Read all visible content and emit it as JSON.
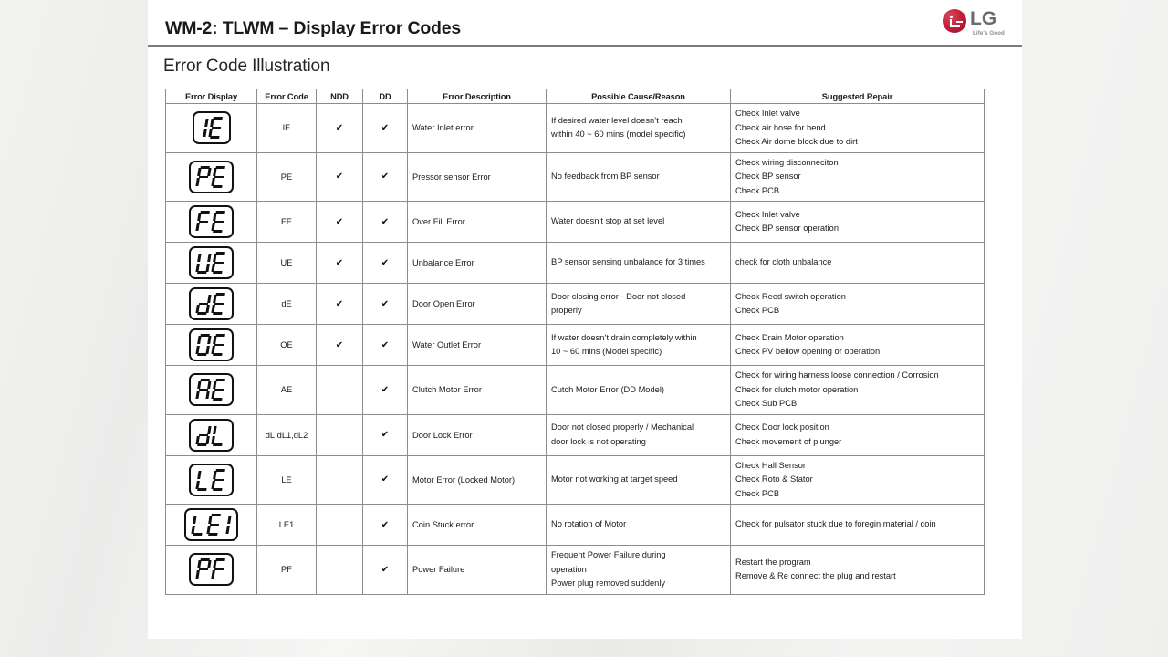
{
  "slide": {
    "title": "WM-2: TLWM – Display Error Codes",
    "section_heading": "Error Code Illustration",
    "logo": {
      "wordmark": "LG",
      "tagline": "Life's Good",
      "brand_color": "#c0203a"
    }
  },
  "table": {
    "columns": [
      "Error Display",
      "Error Code",
      "NDD",
      "DD",
      "Error Description",
      "Possible Cause/Reason",
      "Suggested Repair"
    ],
    "check_glyph": "✔",
    "rows": [
      {
        "display_segments": "1E",
        "code": "IE",
        "ndd": true,
        "dd": true,
        "description": "Water Inlet error",
        "cause": [
          "If desired water level doesn’t reach",
          "within 40 ~ 60 mins (model specific)"
        ],
        "repair": [
          "Check Inlet valve",
          "Check air hose for bend",
          "Check Air dome block due to dirt"
        ]
      },
      {
        "display_segments": "PE",
        "code": "PE",
        "ndd": true,
        "dd": true,
        "description": "Pressor sensor Error",
        "cause": [
          "No feedback from BP sensor"
        ],
        "repair": [
          "Check wiring disconneciton",
          "Check BP sensor",
          "Check PCB"
        ]
      },
      {
        "display_segments": "FE",
        "code": "FE",
        "ndd": true,
        "dd": true,
        "description": "Over Fill Error",
        "cause": [
          "Water doesn’t stop at set level"
        ],
        "repair": [
          "Check Inlet valve",
          "Check BP sensor operation"
        ]
      },
      {
        "display_segments": "UE",
        "code": "UE",
        "ndd": true,
        "dd": true,
        "description": "Unbalance Error",
        "cause": [
          "BP sensor sensing unbalance for 3 times"
        ],
        "repair": [
          "check for cloth unbalance"
        ]
      },
      {
        "display_segments": "dE",
        "code": "dE",
        "ndd": true,
        "dd": true,
        "description": "Door Open Error",
        "cause": [
          "Door closing error - Door not closed",
          "properly"
        ],
        "repair": [
          "Check Reed switch operation",
          "Check PCB"
        ]
      },
      {
        "display_segments": "OE",
        "code": "OE",
        "ndd": true,
        "dd": true,
        "description": "Water Outlet Error",
        "cause": [
          "If water doesn’t drain completely within",
          "10 ~ 60 mins (Model specific)"
        ],
        "repair": [
          "Check Drain Motor operation",
          "Check PV bellow opening or operation"
        ]
      },
      {
        "display_segments": "AE",
        "code": "AE",
        "ndd": false,
        "dd": true,
        "description": "Clutch Motor Error",
        "cause": [
          "Cutch Motor Error (DD Model)"
        ],
        "repair": [
          "Check for wiring harness loose connection / Corrosion",
          "Check for clutch motor operation",
          "Check Sub PCB"
        ]
      },
      {
        "display_segments": "dL",
        "code": "dL,dL1,dL2",
        "ndd": false,
        "dd": true,
        "description": "Door Lock Error",
        "cause": [
          "Door not closed properly / Mechanical",
          "door lock is not operating"
        ],
        "repair": [
          "Check Door lock position",
          "Check movement of plunger"
        ]
      },
      {
        "display_segments": "LE",
        "code": "LE",
        "ndd": false,
        "dd": true,
        "description": "Motor Error (Locked Motor)",
        "cause": [
          "Motor not working at target speed"
        ],
        "repair": [
          "Check Hall Sensor",
          "Check Roto & Stator",
          "Check PCB"
        ]
      },
      {
        "display_segments": "LE1",
        "code": "LE1",
        "ndd": false,
        "dd": true,
        "description": "Coin Stuck error",
        "cause": [
          "No rotation of Motor"
        ],
        "repair": [
          "Check for pulsator stuck due to foregin material / coin"
        ]
      },
      {
        "display_segments": "PF",
        "code": "PF",
        "ndd": false,
        "dd": true,
        "description": "Power Failure",
        "cause": [
          "Frequent Power Failure during",
          "operation",
          "Power plug removed suddenly"
        ],
        "repair": [
          "Restart the program",
          "Remove & Re connect the plug and restart"
        ]
      }
    ]
  }
}
